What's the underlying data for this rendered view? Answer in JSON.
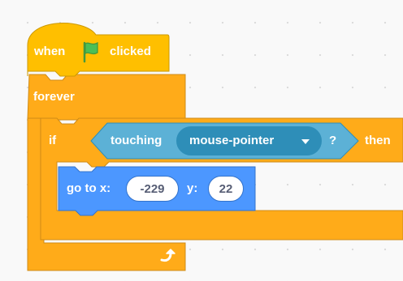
{
  "script": {
    "hat": {
      "label_when": "when",
      "flag_icon": "green-flag-icon",
      "label_clicked": "clicked"
    },
    "forever": {
      "label": "forever",
      "loop_icon": "loop-arrow-icon"
    },
    "if_block": {
      "label_if": "if",
      "label_then": "then",
      "condition": {
        "label": "touching",
        "menu_value": "mouse-pointer",
        "question": "?"
      }
    },
    "motion": {
      "label_goto": "go to x:",
      "x_value": "-229",
      "label_y": "y:",
      "y_value": "22"
    }
  },
  "colors": {
    "events": "#ffbf00",
    "control": "#ffab19",
    "sensing": "#5cb1d6",
    "motion": "#4c97ff",
    "canvas": "#f9f9f9"
  }
}
